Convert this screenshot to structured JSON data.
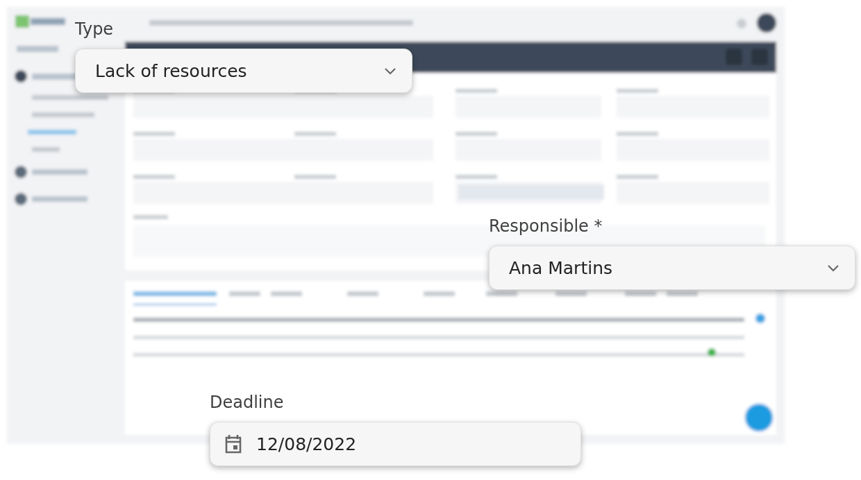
{
  "callouts": [
    {
      "kind": "select",
      "label": "Type",
      "value": "Lack of resources"
    },
    {
      "kind": "select",
      "label": "Responsible *",
      "value": "Ana Martins"
    },
    {
      "kind": "date",
      "label": "Deadline",
      "value": "12/08/2022"
    }
  ]
}
